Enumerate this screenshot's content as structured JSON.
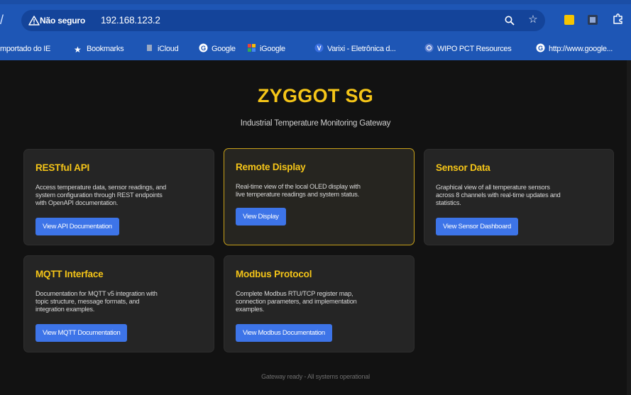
{
  "browser": {
    "insecure_label": "Não seguro",
    "url": "192.168.123.2",
    "colors": {
      "chrome": "#1e56b5",
      "omnibox": "#14449a"
    }
  },
  "bookmarks": [
    {
      "label": "mportado do IE",
      "icon": "folder-icon"
    },
    {
      "label": "Bookmarks",
      "icon": "star-icon"
    },
    {
      "label": "iCloud",
      "icon": "icloud-icon"
    },
    {
      "label": "Google",
      "icon": "google-icon"
    },
    {
      "label": "iGoogle",
      "icon": "igoogle-icon"
    },
    {
      "label": "Varixi - Eletrônica d...",
      "icon": "varixi-icon"
    },
    {
      "label": "WIPO PCT Resources",
      "icon": "wipo-icon"
    },
    {
      "label": "http://www.google...",
      "icon": "google-icon"
    }
  ],
  "page": {
    "title": "ZYGGOT SG",
    "subtitle": "Industrial Temperature Monitoring Gateway",
    "accent_color": "#f5c518",
    "button_color": "#3d74e8"
  },
  "cards": [
    {
      "title": "RESTful API",
      "desc": [
        "Access temperature data, sensor readings, and",
        "system configuration through REST endpoints",
        "with OpenAPI documentation."
      ],
      "button": "View API Documentation"
    },
    {
      "title": "Remote Display",
      "desc": [
        "Real-time view of the local OLED display with",
        "live temperature readings and system status."
      ],
      "button": "View Display"
    },
    {
      "title": "Sensor Data",
      "desc": [
        "Graphical view of all temperature sensors",
        "across 8 channels with real-time updates and",
        "statistics."
      ],
      "button": "View Sensor Dashboard"
    },
    {
      "title": "MQTT Interface",
      "desc": [
        "Documentation for MQTT v5 integration with",
        "topic structure, message formats, and",
        "integration examples."
      ],
      "button": "View MQTT Documentation"
    },
    {
      "title": "Modbus Protocol",
      "desc": [
        "Complete Modbus RTU/TCP register map,",
        "connection parameters, and implementation",
        "examples."
      ],
      "button": "View Modbus Documentation"
    }
  ],
  "footer": "Gateway ready - All systems operational"
}
